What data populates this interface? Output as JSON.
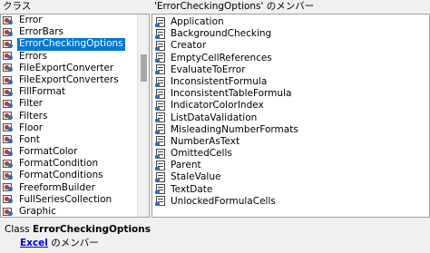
{
  "left_header": "クラス",
  "right_header": "'ErrorCheckingOptions' のメンバー",
  "classes": [
    "Error",
    "ErrorBars",
    "ErrorCheckingOptions",
    "Errors",
    "FileExportConverter",
    "FileExportConverters",
    "FillFormat",
    "Filter",
    "Filters",
    "Floor",
    "Font",
    "FormatColor",
    "FormatCondition",
    "FormatConditions",
    "FreeformBuilder",
    "FullSeriesCollection",
    "Graphic"
  ],
  "selected_class_index": 2,
  "members": [
    "Application",
    "BackgroundChecking",
    "Creator",
    "EmptyCellReferences",
    "EvaluateToError",
    "InconsistentFormula",
    "InconsistentTableFormula",
    "IndicatorColorIndex",
    "ListDataValidation",
    "MisleadingNumberFormats",
    "NumberAsText",
    "OmittedCells",
    "Parent",
    "StaleValue",
    "TextDate",
    "UnlockedFormulaCells"
  ],
  "status": {
    "prefix": "Class ",
    "class_name": "ErrorCheckingOptions",
    "library_link": "Excel",
    "library_suffix": " のメンバー"
  }
}
